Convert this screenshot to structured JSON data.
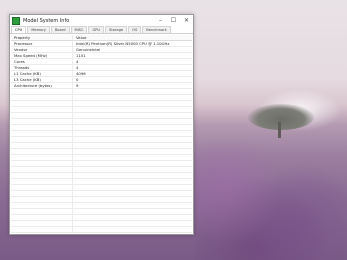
{
  "window": {
    "title": "Model System Info",
    "controls": {
      "minimize": "–",
      "maximize": "☐",
      "close": "✕"
    }
  },
  "tabs": [
    "CPU",
    "Memory",
    "Board",
    "MISC",
    "GPU",
    "Storage",
    "OS",
    "Benchmark"
  ],
  "active_tab": 0,
  "table": {
    "headers": [
      "Property",
      "Value"
    ],
    "rows": [
      [
        "Processor",
        "Intel(R) Pentium(R) Silver N5000 CPU @ 1.10GHz"
      ],
      [
        "Vendor",
        "GenuineIntel"
      ],
      [
        "Max Speed (MHz)",
        "1101"
      ],
      [
        "Cores",
        "4"
      ],
      [
        "Threads",
        "4"
      ],
      [
        "L1 Cache (KB)",
        "4096"
      ],
      [
        "L3 Cache (KB)",
        "0"
      ],
      [
        "Architecture (bytes)",
        "9"
      ]
    ],
    "empty_rows": 27
  },
  "colors": {
    "app_icon": "#2e9e3c",
    "window_bg": "#ffffff",
    "grid_line": "#ececec"
  },
  "icons": [
    "app-icon",
    "minimize-icon",
    "maximize-icon",
    "close-icon"
  ]
}
